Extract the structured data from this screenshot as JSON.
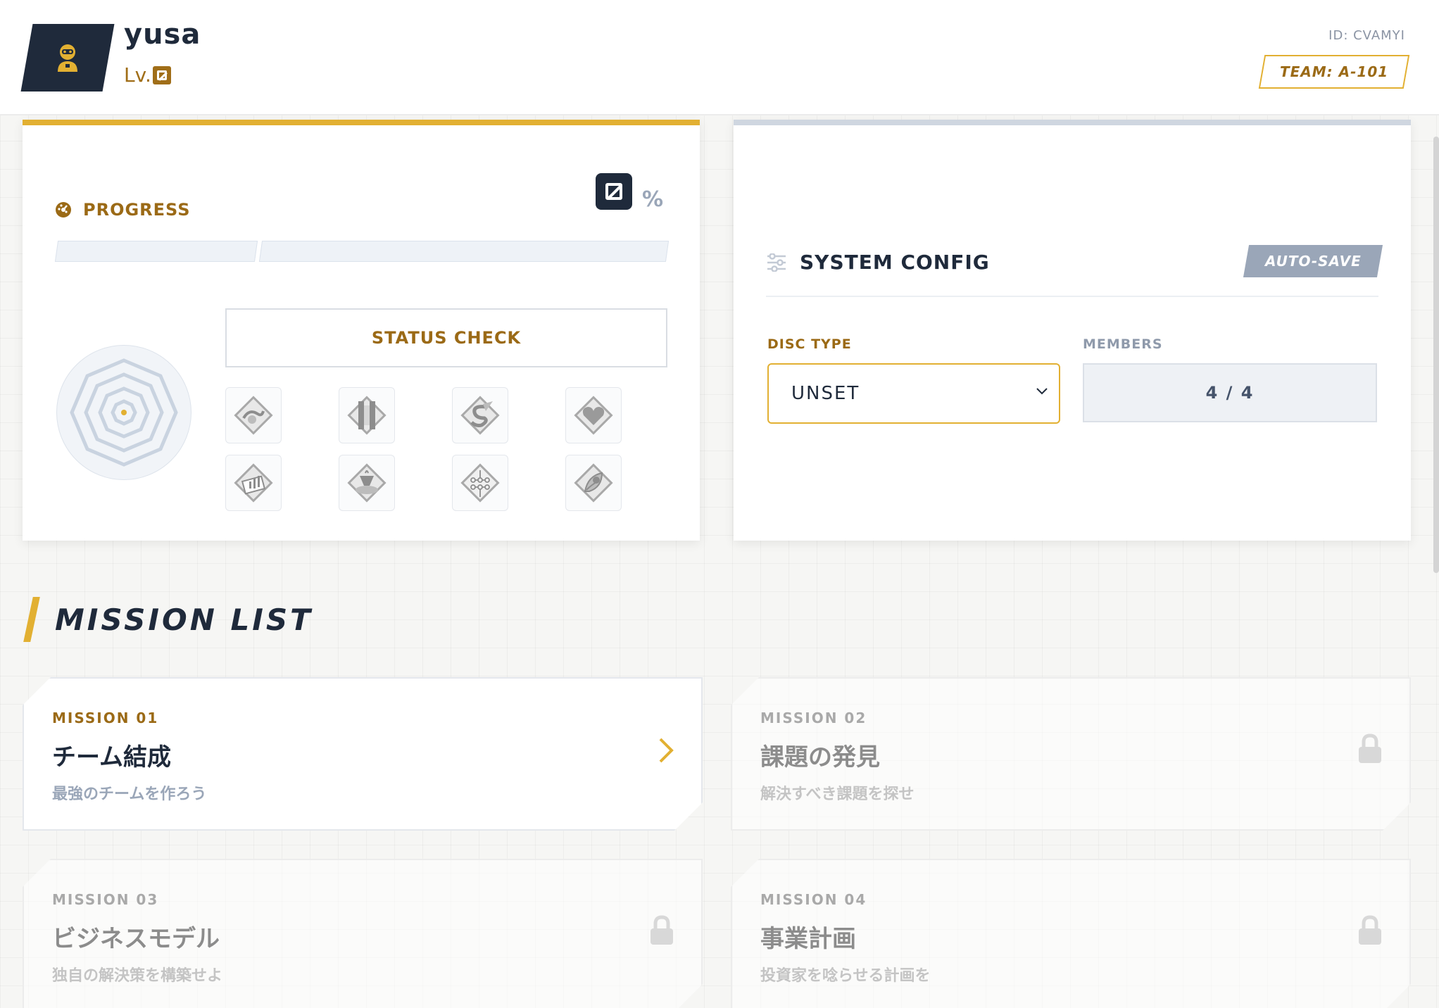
{
  "header": {
    "avatar_icon": "robot-icon",
    "username": "yusa",
    "level_prefix": "Lv.",
    "user_id": "ID: CVAMYI",
    "team": "TEAM: A-101"
  },
  "progress": {
    "title": "PROGRESS",
    "icon": "gauge-icon",
    "percent_sign": "%",
    "status_button": "STATUS CHECK",
    "badges": [
      {
        "name": "wave-badge-icon"
      },
      {
        "name": "pillar-badge-icon"
      },
      {
        "name": "letter-s-badge-icon"
      },
      {
        "name": "heart-badge-icon"
      },
      {
        "name": "chart-badge-icon"
      },
      {
        "name": "cup-badge-icon"
      },
      {
        "name": "circuit-badge-icon"
      },
      {
        "name": "leaf-badge-icon"
      }
    ]
  },
  "config": {
    "title": "SYSTEM CONFIG",
    "icon": "sliders-icon",
    "autosave": "AUTO-SAVE",
    "disc_label": "DISC TYPE",
    "disc_value": "UNSET",
    "members_label": "MEMBERS",
    "members_value": "4 / 4"
  },
  "missions": {
    "heading": "MISSION LIST",
    "items": [
      {
        "num": "MISSION 01",
        "title": "チーム結成",
        "sub": "最強のチームを作ろう",
        "locked": false
      },
      {
        "num": "MISSION 02",
        "title": "課題の発見",
        "sub": "解決すべき課題を探せ",
        "locked": true
      },
      {
        "num": "MISSION 03",
        "title": "ビジネスモデル",
        "sub": "独自の解決策を構築せよ",
        "locked": true
      },
      {
        "num": "MISSION 04",
        "title": "事業計画",
        "sub": "投資家を唸らせる計画を",
        "locked": true
      }
    ]
  },
  "colors": {
    "accent": "#e2b032",
    "accent_dark": "#9b6a16",
    "navy": "#1f2a3b",
    "muted": "#9aa6b8"
  }
}
